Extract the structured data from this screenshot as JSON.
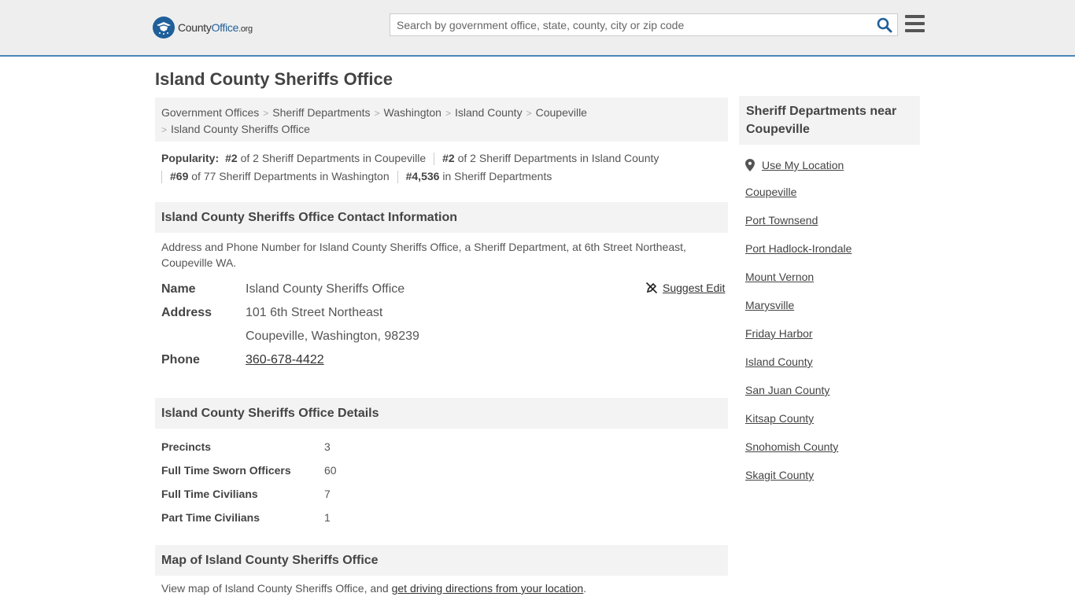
{
  "header": {
    "logo_main": "County",
    "logo_accent": "Office",
    "logo_suffix": ".org",
    "search_placeholder": "Search by government office, state, county, city or zip code"
  },
  "page_title": "Island County Sheriffs Office",
  "breadcrumb": [
    "Government Offices",
    "Sheriff Departments",
    "Washington",
    "Island County",
    "Coupeville",
    "Island County Sheriffs Office"
  ],
  "popularity": {
    "label": "Popularity:",
    "items": [
      {
        "rank": "#2",
        "text": "of 2 Sheriff Departments in Coupeville"
      },
      {
        "rank": "#2",
        "text": "of 2 Sheriff Departments in Island County"
      },
      {
        "rank": "#69",
        "text": "of 77 Sheriff Departments in Washington"
      },
      {
        "rank": "#4,536",
        "text": "in Sheriff Departments"
      }
    ]
  },
  "contact": {
    "heading": "Island County Sheriffs Office Contact Information",
    "intro": "Address and Phone Number for Island County Sheriffs Office, a Sheriff Department, at 6th Street Northeast, Coupeville WA.",
    "name_label": "Name",
    "name": "Island County Sheriffs Office",
    "suggest_edit": "Suggest Edit",
    "address_label": "Address",
    "address_line1": "101 6th Street Northeast",
    "address_line2": "Coupeville, Washington, 98239",
    "phone_label": "Phone",
    "phone": "360-678-4422"
  },
  "details": {
    "heading": "Island County Sheriffs Office Details",
    "rows": [
      {
        "label": "Precincts",
        "value": "3"
      },
      {
        "label": "Full Time Sworn Officers",
        "value": "60"
      },
      {
        "label": "Full Time Civilians",
        "value": "7"
      },
      {
        "label": "Part Time Civilians",
        "value": "1"
      }
    ]
  },
  "map": {
    "heading": "Map of Island County Sheriffs Office",
    "text_before": "View map of Island County Sheriffs Office, and ",
    "link": "get driving directions from your location",
    "text_after": "."
  },
  "sidebar": {
    "heading": "Sheriff Departments near Coupeville",
    "use_location": "Use My Location",
    "links": [
      "Coupeville",
      "Port Townsend",
      "Port Hadlock-Irondale",
      "Mount Vernon",
      "Marysville",
      "Friday Harbor",
      "Island County",
      "San Juan County",
      "Kitsap County",
      "Snohomish County",
      "Skagit County"
    ]
  }
}
